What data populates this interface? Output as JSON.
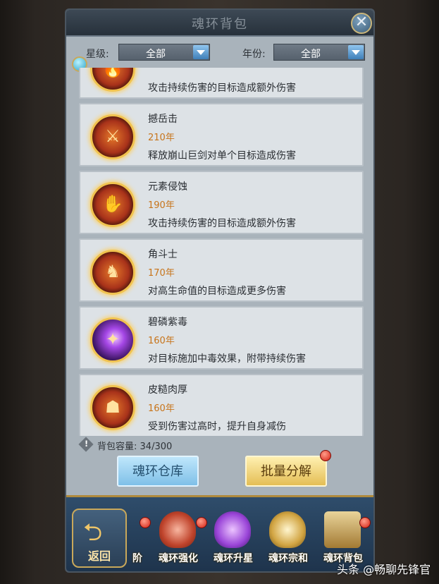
{
  "header": {
    "title": "魂环背包",
    "close_glyph": "✕"
  },
  "filters": {
    "star_label": "星级:",
    "star_value": "全部",
    "year_label": "年份:",
    "year_value": "全部"
  },
  "items": [
    {
      "name": "",
      "years": "",
      "desc": "攻击持续伤害的目标造成额外伤害",
      "icon": "flame-ring-icon"
    },
    {
      "name": "撼岳击",
      "years": "210年",
      "desc": "释放崩山巨剑对单个目标造成伤害",
      "icon": "sword-ring-icon"
    },
    {
      "name": "元素侵蚀",
      "years": "190年",
      "desc": "攻击持续伤害的目标造成额外伤害",
      "icon": "fire-hands-ring-icon"
    },
    {
      "name": "角斗士",
      "years": "170年",
      "desc": "对高生命值的目标造成更多伤害",
      "icon": "gladiator-ring-icon"
    },
    {
      "name": "碧磷紫毒",
      "years": "160年",
      "desc": "对目标施加中毒效果，附带持续伤害",
      "icon": "poison-ring-icon"
    },
    {
      "name": "皮糙肉厚",
      "years": "160年",
      "desc": "受到伤害过高时，提升自身减伤",
      "icon": "armor-ring-icon"
    }
  ],
  "capacity": {
    "label": "背包容量:",
    "value": "34/300"
  },
  "buttons": {
    "warehouse": "魂环仓库",
    "decompose": "批量分解"
  },
  "bottom_nav": {
    "back": "返回",
    "tabs": [
      "阶",
      "魂环强化",
      "魂环升星",
      "魂环宗和",
      "魂环背包"
    ]
  },
  "watermark": "头条 @畅聊先锋官",
  "colors": {
    "year": "#c7741a",
    "badge": "#d42012",
    "panel": "#a9b3bb"
  }
}
